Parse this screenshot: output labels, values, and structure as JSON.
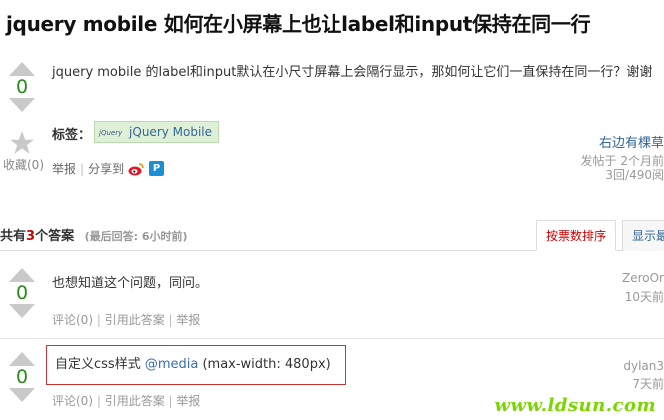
{
  "question": {
    "title": "jquery mobile 如何在小屏幕上也让label和input保持在同一行",
    "votes": "0",
    "body": "jquery mobile 的label和input默认在小尺寸屏幕上会隔行显示，那如何让它们一直保持在同一行？谢谢",
    "favorite": "收藏(0)",
    "tags_label": "标签：",
    "tag_logo": "jQuery",
    "tag": "jQuery Mobile",
    "actions": {
      "report": "举报",
      "divider": "|",
      "share": "分享到"
    },
    "author": "右边有棵草",
    "posted": "发帖于 2个月前",
    "stats": "3回/490阅"
  },
  "answers_header": {
    "prefix": "共有",
    "count": "3",
    "suffix": "个答案",
    "last_reply": "(最后回答: 6小时前)"
  },
  "sort_tabs": {
    "by_votes": "按票数排序",
    "by_other": "显示最"
  },
  "answers": [
    {
      "votes": "0",
      "text": "也想知道这个问题，同问。",
      "author": "ZeroOr",
      "time": "10天前",
      "actions": {
        "comment": "评论(0)",
        "divider": "|",
        "quote": "引用此答案",
        "report": "举报"
      }
    },
    {
      "votes": "0",
      "text_prefix": "自定义css样式 ",
      "text_keyword": "@media",
      "text_suffix": " (max-width: 480px)",
      "author": "dylan3",
      "time": "7天前",
      "actions": {
        "comment": "评论(0)",
        "divider": "|",
        "quote": "引用此答案",
        "report": "举报"
      }
    }
  ],
  "watermark": "www.ldsun.com",
  "colors": {
    "vote_green": "#2b8a1c",
    "link_blue": "#336699",
    "highlight_red": "#cc3333",
    "tag_green_bg": "#dff0d8"
  }
}
